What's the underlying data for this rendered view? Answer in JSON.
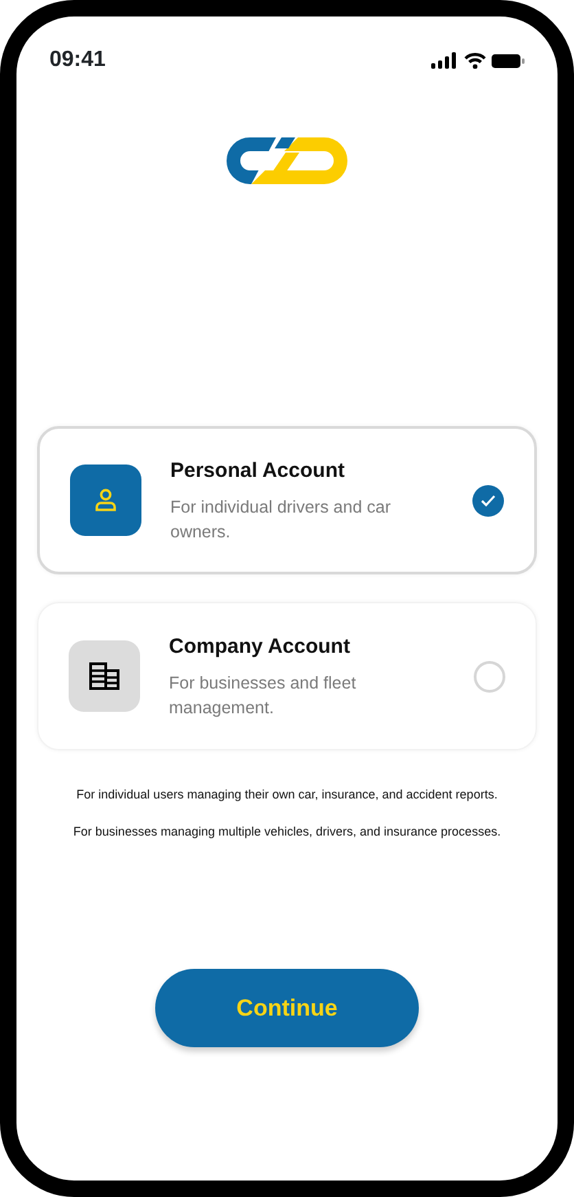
{
  "status_bar": {
    "time": "09:41"
  },
  "accounts": [
    {
      "kind": "personal",
      "title": "Personal Account",
      "description": "For individual drivers and car owners.",
      "selected": true
    },
    {
      "kind": "company",
      "title": "Company Account",
      "description": "For businesses and fleet management.",
      "selected": false
    }
  ],
  "notes": [
    "For individual users managing their own car, insurance, and accident reports.",
    "For businesses managing multiple vehicles, drivers, and insurance processes."
  ],
  "continue_button": {
    "label": "Continue"
  }
}
